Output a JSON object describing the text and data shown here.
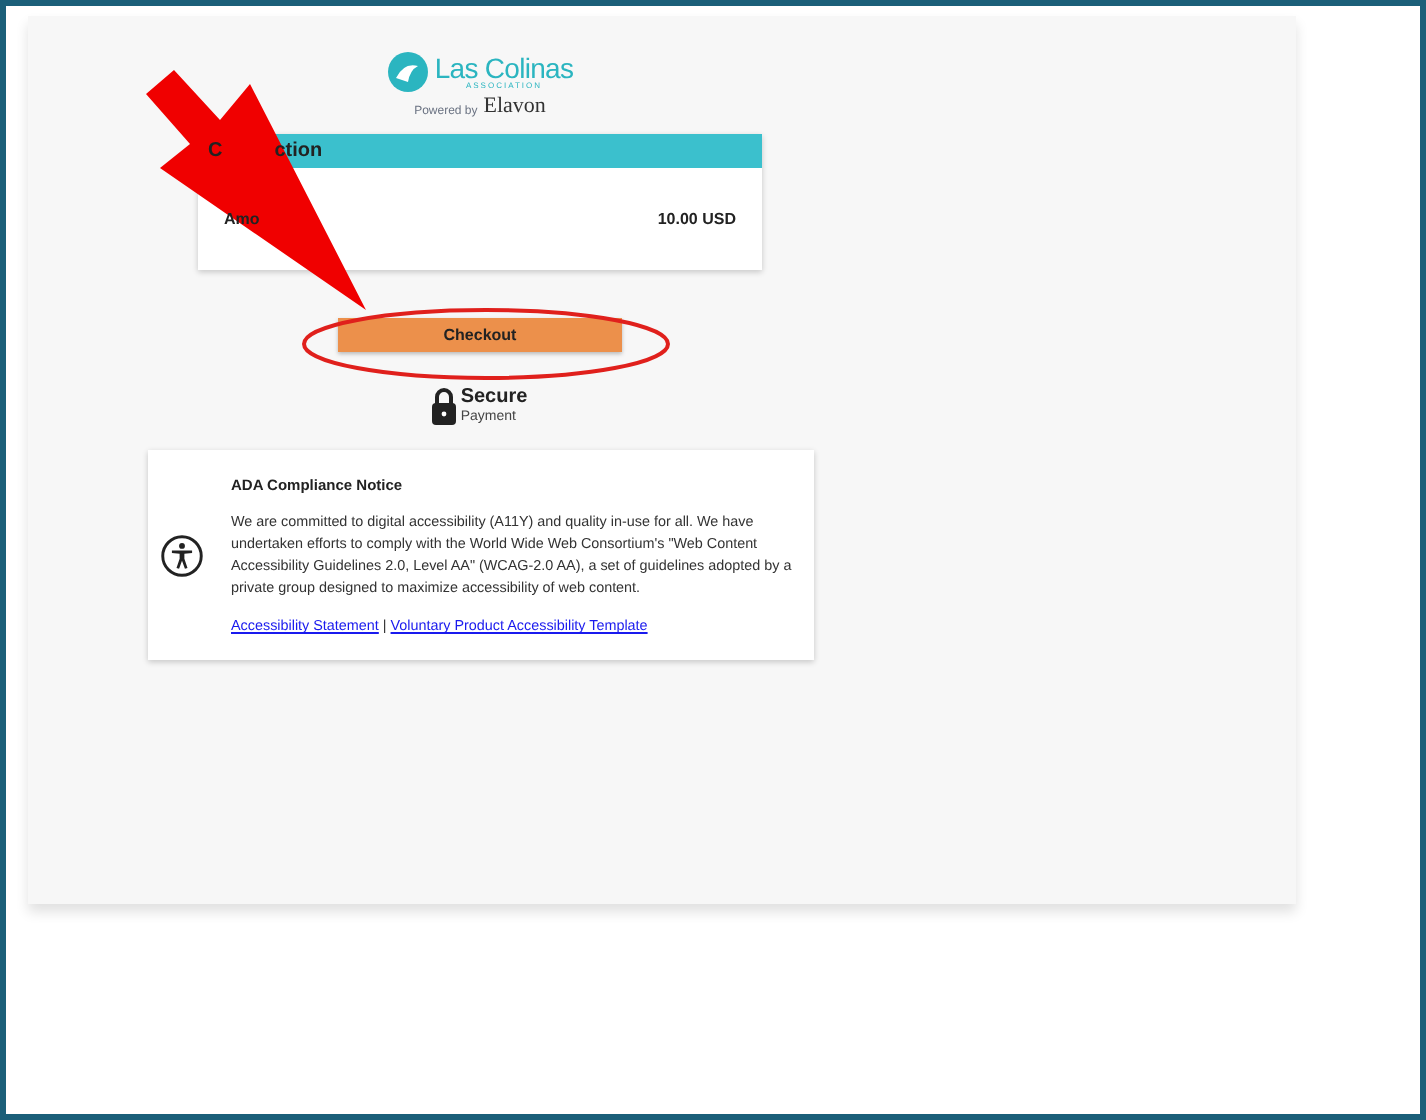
{
  "logo": {
    "name": "Las Colinas",
    "subtitle": "ASSOCIATION",
    "powered_by": "Powered by",
    "partner": "Elavon"
  },
  "transaction": {
    "title_parts": [
      "C",
      "ction"
    ],
    "amount_label": "Amo",
    "amount": "10.00 USD"
  },
  "checkout_button": "Checkout",
  "secure": {
    "title": "Secure",
    "subtitle": "Payment"
  },
  "ada_notice": {
    "title": "ADA Compliance Notice",
    "body": "We are committed to digital accessibility (A11Y) and quality in-use for all. We have undertaken efforts to comply with the World Wide Web Consortium's \"Web Content Accessibility Guidelines 2.0, Level AA\" (WCAG-2.0 AA), a set of guidelines adopted by a private group designed to maximize accessibility of web content.",
    "links": [
      {
        "label": "Accessibility Statement"
      },
      {
        "label": "Voluntary Product Accessibility Template"
      }
    ],
    "separator": "|"
  }
}
